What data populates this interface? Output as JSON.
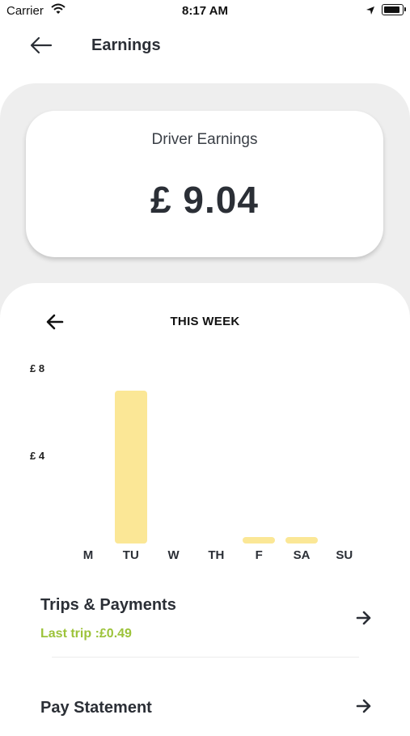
{
  "status_bar": {
    "carrier": "Carrier",
    "time": "8:17 AM"
  },
  "header": {
    "title": "Earnings"
  },
  "earnings": {
    "label": "Driver Earnings",
    "amount": "£ 9.04"
  },
  "chart_header": {
    "title": "THIS WEEK"
  },
  "chart_data": {
    "type": "bar",
    "categories": [
      "M",
      "TU",
      "W",
      "TH",
      "F",
      "SA",
      "SU"
    ],
    "values": [
      0,
      7.0,
      0,
      0,
      0.3,
      0.3,
      0
    ],
    "y_ticks": [
      "£ 8",
      "£ 4"
    ],
    "y_tick_values": [
      8,
      4
    ],
    "ylim": [
      0,
      8
    ],
    "bar_color": "#fbe796"
  },
  "trips": {
    "title": "Trips & Payments",
    "subtitle": "Last trip :£0.49"
  },
  "statement": {
    "title": "Pay Statement"
  },
  "colors": {
    "accent_green": "#9cc33a",
    "bar": "#fbe796",
    "panel": "#eeeeee"
  }
}
